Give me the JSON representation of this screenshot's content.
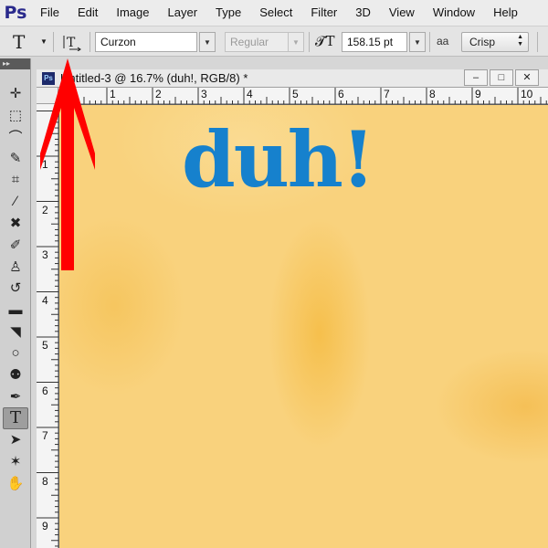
{
  "app": {
    "logo": "Ps",
    "menu": [
      "File",
      "Edit",
      "Image",
      "Layer",
      "Type",
      "Select",
      "Filter",
      "3D",
      "View",
      "Window",
      "Help"
    ]
  },
  "options": {
    "tool_glyph": "T",
    "orientation_icon": "toggle-text-orientation-icon",
    "font_family": "Curzon",
    "font_style": "Regular",
    "font_size": "158.15 pt",
    "aa_label": "aa",
    "antialias": "Crisp"
  },
  "document": {
    "ps_badge": "Ps",
    "title": "Untitled-3 @ 16.7% (duh!, RGB/8) *",
    "minimize": "‒",
    "restore": "□",
    "close": "✕",
    "ruler_h": [
      "1",
      "2",
      "3",
      "4",
      "5",
      "6",
      "7",
      "8",
      "9",
      "10"
    ],
    "ruler_v": [
      "1",
      "2",
      "3",
      "4",
      "5",
      "6",
      "7",
      "8",
      "9"
    ],
    "canvas_text": "duh!",
    "canvas_text_color": "#1681cd",
    "canvas_color": "#f9d27d"
  },
  "tools": [
    {
      "name": "move-tool-icon",
      "glyph": "✛"
    },
    {
      "name": "marquee-tool-icon",
      "glyph": "⬚"
    },
    {
      "name": "lasso-tool-icon",
      "glyph": "⌒"
    },
    {
      "name": "quick-selection-tool-icon",
      "glyph": "✎"
    },
    {
      "name": "crop-tool-icon",
      "glyph": "⌗"
    },
    {
      "name": "eyedropper-tool-icon",
      "glyph": "∕"
    },
    {
      "name": "healing-brush-tool-icon",
      "glyph": "✖"
    },
    {
      "name": "brush-tool-icon",
      "glyph": "✐"
    },
    {
      "name": "clone-stamp-tool-icon",
      "glyph": "♙"
    },
    {
      "name": "history-brush-tool-icon",
      "glyph": "↺"
    },
    {
      "name": "eraser-tool-icon",
      "glyph": "▬"
    },
    {
      "name": "paint-bucket-tool-icon",
      "glyph": "◥"
    },
    {
      "name": "blur-tool-icon",
      "glyph": "○"
    },
    {
      "name": "dodge-tool-icon",
      "glyph": "⚉"
    },
    {
      "name": "pen-tool-icon",
      "glyph": "✒"
    },
    {
      "name": "type-tool-icon",
      "glyph": "T"
    },
    {
      "name": "path-selection-tool-icon",
      "glyph": "➤"
    },
    {
      "name": "shape-tool-icon",
      "glyph": "✶"
    },
    {
      "name": "hand-tool-icon",
      "glyph": "✋"
    }
  ],
  "annotation": {
    "color": "#ff0000",
    "icon": "red-arrow-icon"
  }
}
